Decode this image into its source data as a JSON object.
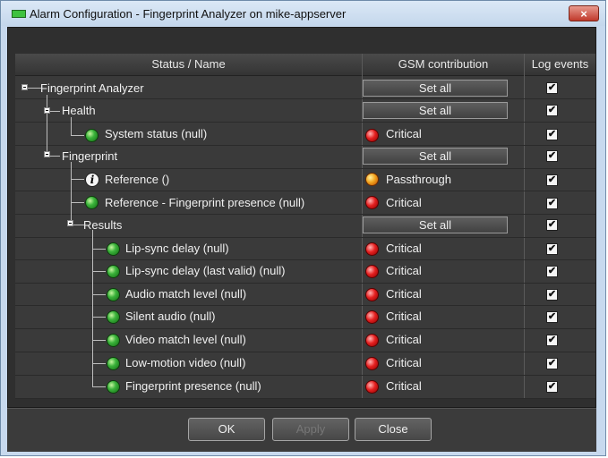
{
  "window": {
    "title": "Alarm Configuration - Fingerprint Analyzer on mike-appserver",
    "close_label": "×"
  },
  "table": {
    "columns": [
      "Status / Name",
      "GSM contribution",
      "Log events"
    ],
    "set_all_label": "Set all",
    "check_mark": "✔",
    "rows": [
      {
        "name": "Fingerprint Analyzer",
        "gsm": "Set all"
      },
      {
        "name": "Health",
        "gsm": "Set all"
      },
      {
        "name": "System status (null)",
        "gsm": "Critical",
        "status_icon": "green-light-icon",
        "gsm_icon": "red-light-icon"
      },
      {
        "name": "Fingerprint",
        "gsm": "Set all"
      },
      {
        "name": "Reference ()",
        "gsm": "Passthrough",
        "status_icon": "info-icon",
        "gsm_icon": "orange-light-icon",
        "info_glyph": "i"
      },
      {
        "name": "Reference - Fingerprint presence (null)",
        "gsm": "Critical",
        "status_icon": "green-light-icon",
        "gsm_icon": "red-light-icon"
      },
      {
        "name": "Results",
        "gsm": "Set all"
      },
      {
        "name": "Lip-sync delay (null)",
        "gsm": "Critical",
        "status_icon": "green-light-icon",
        "gsm_icon": "red-light-icon"
      },
      {
        "name": "Lip-sync delay (last valid) (null)",
        "gsm": "Critical",
        "status_icon": "green-light-icon",
        "gsm_icon": "red-light-icon"
      },
      {
        "name": "Audio match level (null)",
        "gsm": "Critical",
        "status_icon": "green-light-icon",
        "gsm_icon": "red-light-icon"
      },
      {
        "name": "Silent audio (null)",
        "gsm": "Critical",
        "status_icon": "green-light-icon",
        "gsm_icon": "red-light-icon"
      },
      {
        "name": "Video match level (null)",
        "gsm": "Critical",
        "status_icon": "green-light-icon",
        "gsm_icon": "red-light-icon"
      },
      {
        "name": "Low-motion video (null)",
        "gsm": "Critical",
        "status_icon": "green-light-icon",
        "gsm_icon": "red-light-icon"
      },
      {
        "name": "Fingerprint presence (null)",
        "gsm": "Critical",
        "status_icon": "green-light-icon",
        "gsm_icon": "red-light-icon"
      }
    ]
  },
  "buttons": {
    "ok": "OK",
    "apply": "Apply",
    "close": "Close"
  },
  "colors": {
    "critical": "#e52020",
    "passthrough": "#f2a41f",
    "status_ok": "#3bb33b"
  }
}
